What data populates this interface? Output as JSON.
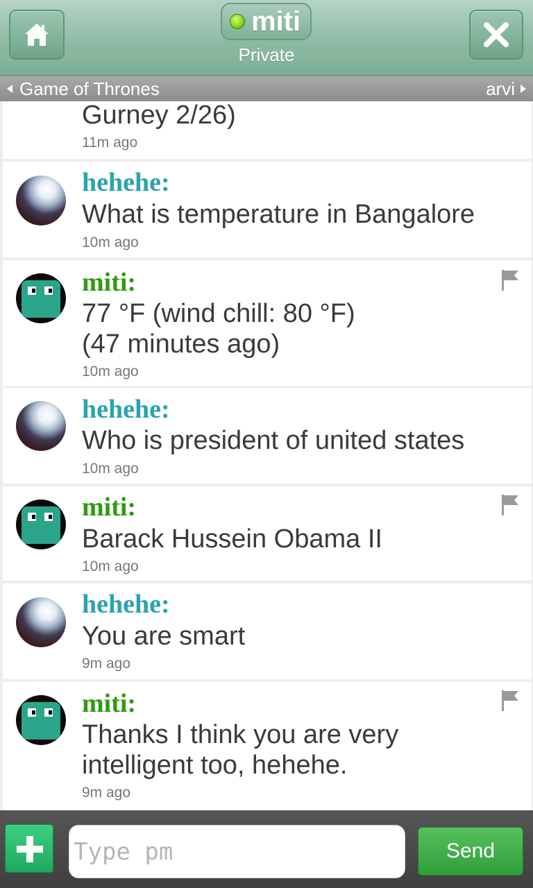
{
  "header": {
    "home_icon": "home-icon",
    "close_icon": "close-x-icon",
    "chat_name": "miti",
    "chat_subtitle": "Private",
    "status_color": "#7fd11b"
  },
  "room_bar": {
    "prev_room": "Game of Thrones",
    "next_room": "arvi"
  },
  "messages": [
    {
      "author": "",
      "text": "Gurney 2/26)",
      "time": "11m ago"
    },
    {
      "author": "hehehe:",
      "text": "What is temperature in Bangalore",
      "time": "10m ago"
    },
    {
      "author": "miti:",
      "text_lines": [
        "77 °F (wind chill: 80 °F)",
        "(47 minutes ago)"
      ],
      "time": "10m ago",
      "flag_icon": "flag-icon"
    },
    {
      "author": "hehehe:",
      "text": "Who is president of united states",
      "time": "10m ago"
    },
    {
      "author": "miti:",
      "text": "Barack Hussein Obama II",
      "time": "10m ago",
      "flag_icon": "flag-icon"
    },
    {
      "author": "hehehe:",
      "text": "You are smart",
      "time": "9m ago"
    },
    {
      "author": "miti:",
      "text_lines": [
        "Thanks I think you are very",
        "intelligent too, hehehe."
      ],
      "time": "9m ago",
      "flag_icon": "flag-icon"
    }
  ],
  "composer": {
    "plus_icon": "plus-icon",
    "placeholder": "Type pm",
    "value": "",
    "send_label": "Send"
  },
  "colors": {
    "guest_name": "#2ba3b0",
    "bot_name": "#2f9a12",
    "send_button": "#3aaa46"
  }
}
